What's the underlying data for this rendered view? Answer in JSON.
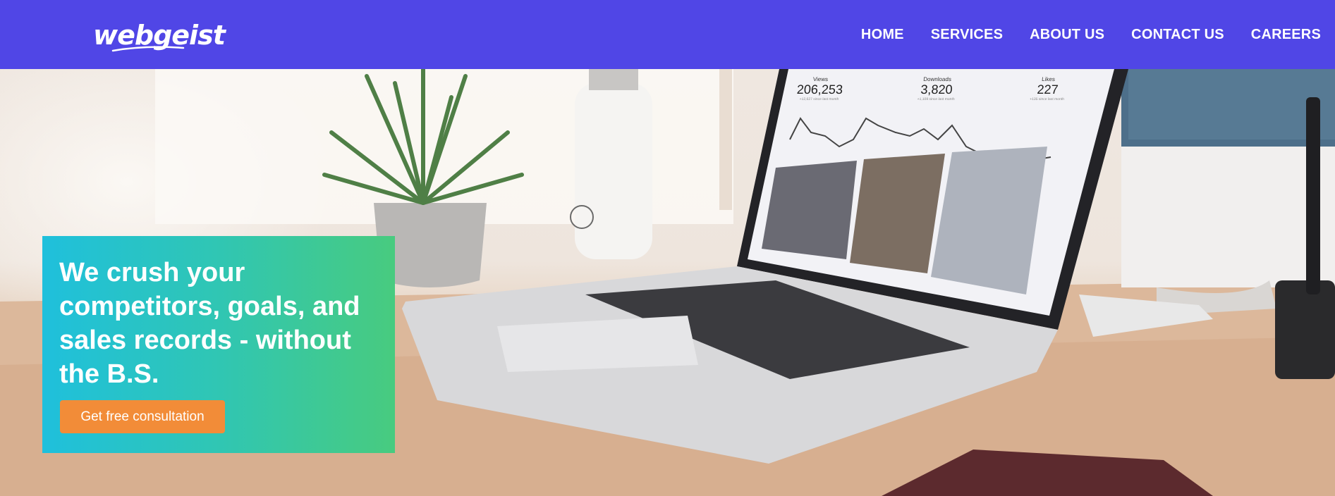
{
  "brand": {
    "logo_text": "webgeist"
  },
  "nav": {
    "items": [
      "HOME",
      "SERVICES",
      "ABOUT US",
      "CONTACT US",
      "CAREERS"
    ]
  },
  "hero": {
    "headline": "We crush your competitors, goals, and sales records - without the B.S.",
    "cta_label": "Get free consultation"
  },
  "laptop_screen": {
    "stats": [
      {
        "label": "Views",
        "value": "206,253",
        "note": "+12,627 since last month"
      },
      {
        "label": "Downloads",
        "value": "3,820",
        "note": "+1,109 since last month"
      },
      {
        "label": "Likes",
        "value": "227",
        "note": "+135 since last month"
      }
    ]
  },
  "colors": {
    "nav_bg": "#5046e6",
    "card_gradient_start": "#1fc0dc",
    "card_gradient_end": "#48cb7f",
    "cta_bg": "#f28c38"
  }
}
